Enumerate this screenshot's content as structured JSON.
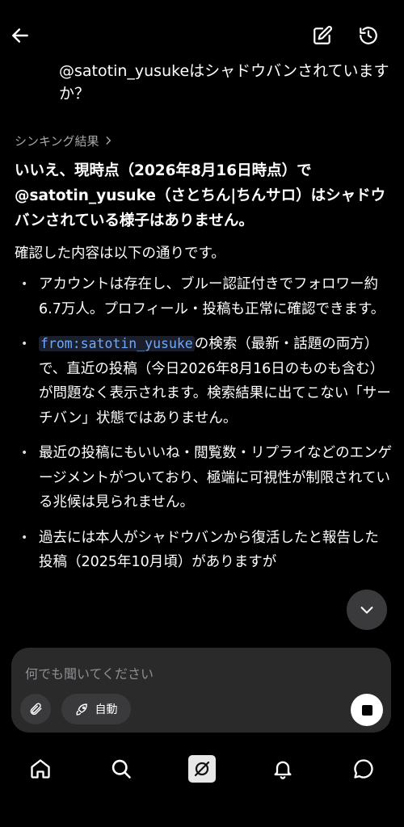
{
  "header": {
    "back_icon": "arrow-left-icon",
    "compose_icon": "edit-icon",
    "history_icon": "history-icon"
  },
  "user_message": "@satotin_yusukeはシャドウバンされていますか？",
  "thinking_label": "シンキング結果",
  "answer": {
    "headline": "いいえ、現時点（2026年8月16日時点）で@satotin_yusuke（さとちん|ちんサロ）はシャドウバンされている様子はありません。",
    "intro": "確認した内容は以下の通りです。",
    "bullet1": "アカウントは存在し、ブルー認証付きでフォロワー約6.7万人。プロフィール・投稿も正常に確認できます。",
    "bullet2_code": "from:satotin_yusuke",
    "bullet2_rest": "の検索（最新・話題の両方）で、直近の投稿（今日2026年8月16日のものも含む）が問題なく表示されます。検索結果に出てこない「サーチバン」状態ではありません。",
    "bullet3": "最近の投稿にもいいね・閲覧数・リプライなどのエンゲージメントがついており、極端に可視性が制限されている兆候は見られません。",
    "bullet4": "過去には本人がシャドウバンから復活したと報告した投稿（2025年10月頃）がありますが"
  },
  "composer": {
    "placeholder": "何でも聞いてください",
    "mode_label": "自動"
  },
  "tabs": [
    "home",
    "search",
    "grok",
    "notifications",
    "messages"
  ],
  "colors": {
    "background": "#000000",
    "code": "#6ea8ff",
    "composer": "#2a2a2b"
  }
}
